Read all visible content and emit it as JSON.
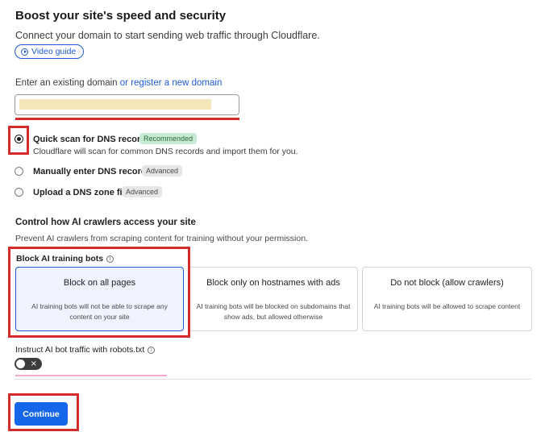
{
  "header": {
    "title": "Boost your site's speed and security",
    "subtitle": "Connect your domain to start sending web traffic through Cloudflare.",
    "video_guide_label": "Video guide",
    "video_icon": "play-circle-icon"
  },
  "domain": {
    "label": "Enter an existing domain",
    "register_link": "or register a new domain",
    "value": ""
  },
  "dns_options": [
    {
      "label": "Quick scan for DNS records",
      "badge": "Recommended",
      "description": "Cloudflare will scan for common DNS records and import them for you.",
      "selected": true
    },
    {
      "label": "Manually enter DNS records",
      "badge": "Advanced",
      "selected": false
    },
    {
      "label": "Upload a DNS zone file",
      "badge": "Advanced",
      "selected": false
    }
  ],
  "ai_crawlers": {
    "title": "Control how AI crawlers access your site",
    "description": "Prevent AI crawlers from scraping content for training without your permission.",
    "block_label": "Block AI training bots",
    "info_icon": "info-icon",
    "cards": [
      {
        "title": "Block on all pages",
        "description": "AI training bots will not be able to scrape any content on your site",
        "selected": true
      },
      {
        "title": "Block only on hostnames with ads",
        "description": "AI training bots will be blocked on subdomains that show ads, but allowed otherwise",
        "selected": false
      },
      {
        "title": "Do not block (allow crawlers)",
        "description": "AI training bots will be allowed to scrape content",
        "selected": false
      }
    ],
    "robots_label": "Instruct AI bot traffic with robots.txt",
    "robots_toggle": "off",
    "toggle_off_glyph": "×"
  },
  "footer": {
    "continue_label": "Continue"
  },
  "colors": {
    "accent": "#1f5bd6",
    "primary_button": "#1566e8",
    "highlight_red": "#d42b2b",
    "recommended_badge": "#c9ead2"
  }
}
